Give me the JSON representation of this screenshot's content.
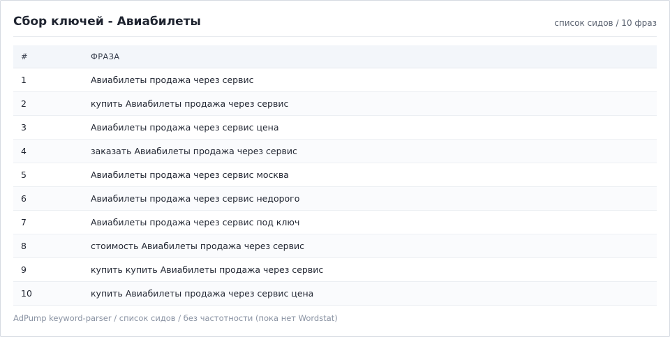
{
  "header": {
    "title": "Сбор ключей - Авиабилеты",
    "subtitle": "список сидов / 10 фраз"
  },
  "table": {
    "columns": [
      "#",
      "ФРАЗА"
    ],
    "rows": [
      {
        "num": "1",
        "phrase": "Авиабилеты продажа через сервис"
      },
      {
        "num": "2",
        "phrase": "купить Авиабилеты продажа через сервис"
      },
      {
        "num": "3",
        "phrase": "Авиабилеты продажа через сервис цена"
      },
      {
        "num": "4",
        "phrase": "заказать Авиабилеты продажа через сервис"
      },
      {
        "num": "5",
        "phrase": "Авиабилеты продажа через сервис москва"
      },
      {
        "num": "6",
        "phrase": "Авиабилеты продажа через сервис недорого"
      },
      {
        "num": "7",
        "phrase": "Авиабилеты продажа через сервис под ключ"
      },
      {
        "num": "8",
        "phrase": "стоимость Авиабилеты продажа через сервис"
      },
      {
        "num": "9",
        "phrase": "купить купить Авиабилеты продажа через сервис"
      },
      {
        "num": "10",
        "phrase": "купить Авиабилеты продажа через сервис цена"
      }
    ]
  },
  "footer": {
    "text": "AdPump keyword-parser / список сидов / без частотности (пока нет Wordstat)"
  },
  "colors": {
    "header_bg": "#f3f6fa",
    "border": "#d5dae1",
    "text": "#1f2430",
    "muted": "#8a93a3"
  }
}
